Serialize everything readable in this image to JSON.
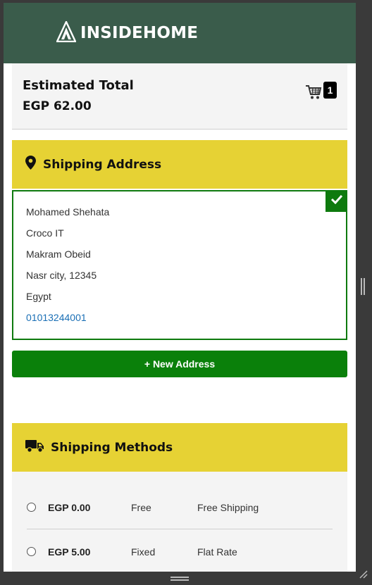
{
  "header": {
    "logo_text": "INSIDEHOME"
  },
  "summary": {
    "title": "Estimated Total",
    "total": "EGP 62.00",
    "cart_count": "1"
  },
  "shipping_address": {
    "heading": "Shipping Address",
    "lines": [
      "Mohamed Shehata",
      "Croco IT",
      "Makram Obeid",
      "Nasr city, 12345",
      "Egypt"
    ],
    "phone": "01013244001",
    "new_address_button": "+ New Address"
  },
  "shipping_methods": {
    "heading": "Shipping Methods",
    "methods": [
      {
        "price": "EGP 0.00",
        "type": "Free",
        "name": "Free Shipping"
      },
      {
        "price": "EGP 5.00",
        "type": "Fixed",
        "name": "Flat Rate"
      }
    ]
  },
  "colors": {
    "header_bg": "#3a5c4b",
    "section_accent": "#e6d234",
    "selected_green": "#0e7a0e",
    "button_green": "#0a800a",
    "link_blue": "#1a6fb5"
  },
  "icons": [
    "logo-icon",
    "cart-icon",
    "map-pin-icon",
    "checkmark-icon",
    "truck-icon"
  ]
}
